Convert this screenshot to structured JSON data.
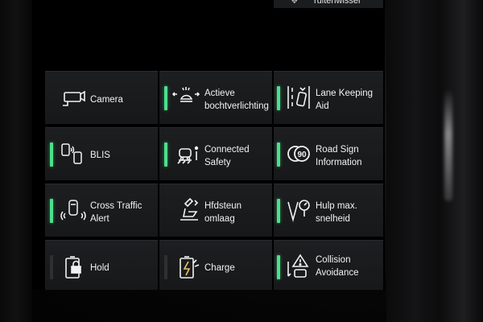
{
  "top_strip": {
    "icon": "wiper-fluid-icon",
    "label": "ruitenwisser"
  },
  "tiles": [
    {
      "key": "camera",
      "label": "Camera",
      "icon": "camera-icon",
      "indicator": "none"
    },
    {
      "key": "active-bending-lights",
      "label": "Actieve\nbochtverlichting",
      "icon": "headlight-icon",
      "indicator": "on"
    },
    {
      "key": "lane-keeping-aid",
      "label": "Lane Keeping\nAid",
      "icon": "lane-keeping-icon",
      "indicator": "on"
    },
    {
      "key": "blis",
      "label": "BLIS",
      "icon": "blind-spot-icon",
      "indicator": "on"
    },
    {
      "key": "connected-safety",
      "label": "Connected\nSafety",
      "icon": "connected-safety-icon",
      "indicator": "on"
    },
    {
      "key": "road-sign-information",
      "label": "Road Sign\nInformation",
      "icon": "road-sign-icon",
      "indicator": "on"
    },
    {
      "key": "cross-traffic-alert",
      "label": "Cross Traffic\nAlert",
      "icon": "cross-traffic-icon",
      "indicator": "on"
    },
    {
      "key": "headrest-fold",
      "label": "Hfdsteun\nomlaag",
      "icon": "headrest-icon",
      "indicator": "none"
    },
    {
      "key": "hill-descent",
      "label": "Hulp max.\nsnelheid",
      "icon": "speed-limiter-icon",
      "indicator": "on"
    },
    {
      "key": "hold",
      "label": "Hold",
      "icon": "battery-hold-icon",
      "indicator": "off"
    },
    {
      "key": "charge",
      "label": "Charge",
      "icon": "battery-charge-icon",
      "indicator": "off"
    },
    {
      "key": "collision-avoidance",
      "label": "Collision\nAvoidance",
      "icon": "collision-warning-icon",
      "indicator": "on"
    }
  ],
  "colors": {
    "indicator_on": "#4be08c",
    "indicator_off": "#2e2f31",
    "tile_bg": "#1b1c1e",
    "text": "#f2f2f2"
  }
}
